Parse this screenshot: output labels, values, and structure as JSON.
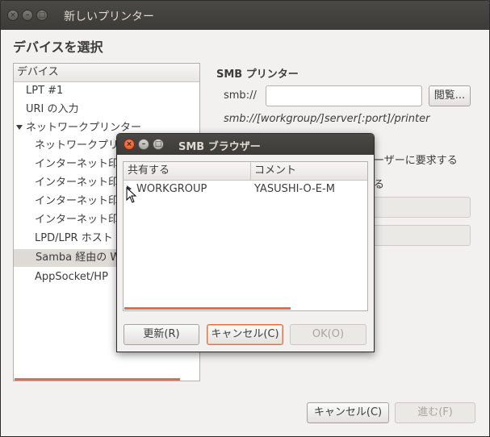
{
  "window": {
    "title": "新しいプリンター",
    "close_glyph": "×",
    "min_glyph": "–",
    "max_glyph": "□"
  },
  "heading": "デバイスを選択",
  "device_list": {
    "header": "デバイス",
    "items": [
      "LPT #1",
      "URI の入力",
      "ネットワークプリンター",
      "ネットワークプリ",
      "インターネット印",
      "インターネット印",
      "インターネット印",
      "インターネット印",
      "LPD/LPR ホスト",
      "Samba 経由の W",
      "AppSocket/HP"
    ]
  },
  "smb_panel": {
    "title": "SMB プリンター",
    "smb_label": "smb://",
    "smb_value": "",
    "browse_button": "閲覧...",
    "format_hint": "smb://[workgroup/]server[:port]/printer",
    "partial_text_1": "ーザーに要求する",
    "partial_text_2": "る"
  },
  "footer": {
    "cancel_button": "キャンセル(C)",
    "forward_button": "進む(F)"
  },
  "smb_dialog": {
    "title": "SMB ブラウザー",
    "close_glyph": "×",
    "min_glyph": "–",
    "max_glyph": "□",
    "columns": [
      "共有する",
      "コメント"
    ],
    "rows": [
      {
        "name": "WORKGROUP",
        "comment": "YASUSHI-O-E-M"
      }
    ],
    "refresh_button": "更新(R)",
    "cancel_button": "キャンセル(C)",
    "ok_button": "OK(O)"
  }
}
